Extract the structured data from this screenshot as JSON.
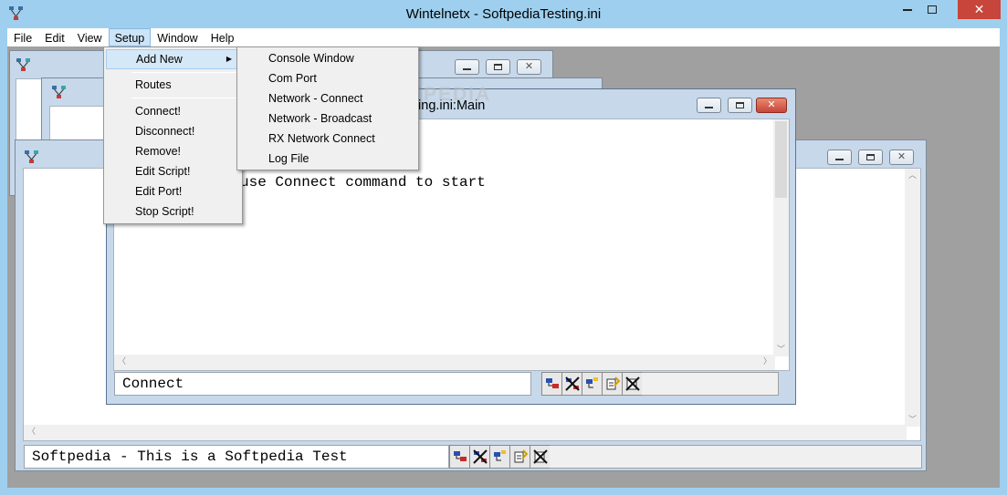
{
  "window": {
    "title": "Wintelnetx - SoftpediaTesting.ini"
  },
  "menubar": {
    "items": [
      {
        "label": "File"
      },
      {
        "label": "Edit"
      },
      {
        "label": "View"
      },
      {
        "label": "Setup"
      },
      {
        "label": "Window"
      },
      {
        "label": "Help"
      }
    ]
  },
  "setup_menu": {
    "items": [
      {
        "label": "Add New",
        "has_submenu": true
      },
      {
        "label": "Routes"
      },
      {
        "label": "Connect!"
      },
      {
        "label": "Disconnect!"
      },
      {
        "label": "Remove!"
      },
      {
        "label": "Edit Script!"
      },
      {
        "label": "Edit Port!"
      },
      {
        "label": "Stop Script!"
      }
    ]
  },
  "add_new_submenu": {
    "items": [
      {
        "label": "Console Window"
      },
      {
        "label": "Com Port"
      },
      {
        "label": "Network - Connect"
      },
      {
        "label": "Network - Broadcast"
      },
      {
        "label": "RX Network Connect"
      },
      {
        "label": "Log File"
      }
    ]
  },
  "main_child": {
    "title_fragment": "ting.ini:Main",
    "console_line": "use Connect command to start",
    "command_value": "Connect"
  },
  "bottom_child": {
    "command_value": "Softpedia - This is a Softpedia Test"
  },
  "watermark": "SOFTPEDIA",
  "colors": {
    "accent_bg": "#9ecfee",
    "close_red": "#c7453a",
    "menu_highlight": "#cbe4f7"
  }
}
